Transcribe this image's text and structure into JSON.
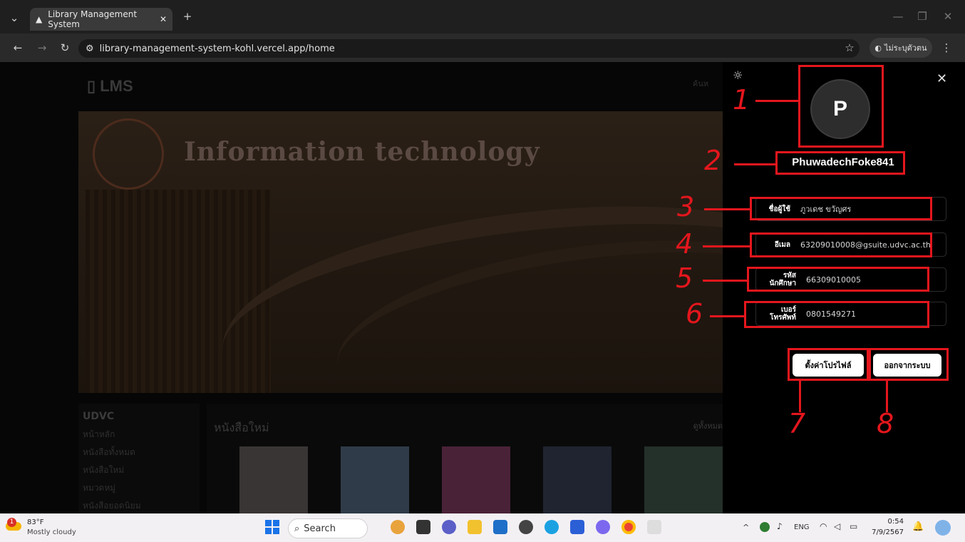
{
  "browser": {
    "tab_title": "Library Management System",
    "url": "library-management-system-kohl.vercel.app/home",
    "profile_label": "ไม่ระบุตัวตน"
  },
  "page": {
    "logo": "LMS",
    "search_hint": "ค้นห",
    "hero_title": "Information technology",
    "sidebar": {
      "title": "UDVC",
      "items": [
        "หน้าหลัก",
        "หนังสือทั้งหมด",
        "หนังสือใหม่",
        "หมวดหมู่",
        "หนังสือยอดนิยม"
      ]
    },
    "new_books_title": "หนังสือใหม่",
    "see_all": "ดูทั้งหมด"
  },
  "profile": {
    "avatar_letter": "P",
    "username": "PhuwadechFoke841",
    "fields": [
      {
        "label": "ชื่อผู้ใช้",
        "value": "ภูวเดช ขวัญศร"
      },
      {
        "label": "อีเมล",
        "value": "63209010008@gsuite.udvc.ac.th"
      },
      {
        "label": "รหัส นักศึกษา",
        "value": "66309010005"
      },
      {
        "label": "เบอร์ โทรศัพท์",
        "value": "0801549271"
      }
    ],
    "settings_button": "ตั้งค่าโปรไฟล์",
    "logout_button": "ออกจากระบบ"
  },
  "annotations": [
    "1",
    "2",
    "3",
    "4",
    "5",
    "6",
    "7",
    "8"
  ],
  "taskbar": {
    "weather_temp": "83°F",
    "weather_desc": "Mostly cloudy",
    "weather_badge": "1",
    "search_label": "Search",
    "lang": "ENG",
    "time": "0:54",
    "date": "7/9/2567"
  },
  "colors": {
    "annotation_red": "#e4161d",
    "panel_bg": "#000000"
  }
}
